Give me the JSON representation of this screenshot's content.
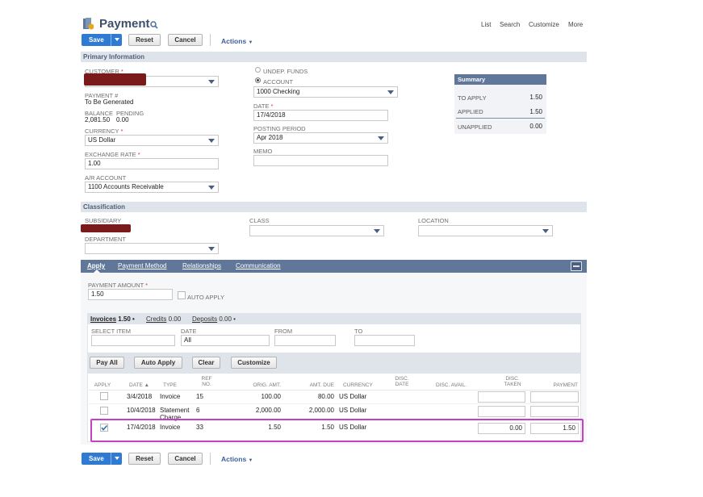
{
  "header": {
    "title": "Payment",
    "nav": [
      "List",
      "Search",
      "Customize",
      "More"
    ]
  },
  "toolbar": {
    "save": "Save",
    "reset": "Reset",
    "cancel": "Cancel",
    "actions": "Actions"
  },
  "primary": {
    "section_title": "Primary Information",
    "customer_label": "CUSTOMER",
    "required_mark": "*",
    "payment_no_label": "PAYMENT #",
    "payment_no_value": "To Be Generated",
    "balance_label": "BALANCE",
    "pending_label": "PENDING",
    "balance_value": "2,081.50",
    "pending_value": "0.00",
    "currency_label": "CURRENCY",
    "currency_value": "US Dollar",
    "exchange_rate_label": "EXCHANGE RATE",
    "exchange_rate_value": "1.00",
    "ar_account_label": "A/R ACCOUNT",
    "ar_account_value": "1100 Accounts Receivable",
    "undep_funds_label": "UNDEP. FUNDS",
    "account_label": "ACCOUNT",
    "account_value": "1000 Checking",
    "date_label": "DATE",
    "date_value": "17/4/2018",
    "posting_period_label": "POSTING PERIOD",
    "posting_period_value": "Apr 2018",
    "memo_label": "MEMO",
    "memo_value": ""
  },
  "summary": {
    "title": "Summary",
    "to_apply_label": "TO APPLY",
    "to_apply_value": "1.50",
    "applied_label": "APPLIED",
    "applied_value": "1.50",
    "unapplied_label": "UNAPPLIED",
    "unapplied_value": "0.00"
  },
  "classification": {
    "section_title": "Classification",
    "subsidiary_label": "SUBSIDIARY",
    "department_label": "DEPARTMENT",
    "class_label": "CLASS",
    "location_label": "LOCATION"
  },
  "tabs": [
    "Apply",
    "Payment Method",
    "Relationships",
    "Communication"
  ],
  "apply": {
    "payment_amount_label": "PAYMENT AMOUNT",
    "payment_amount_value": "1.50",
    "auto_apply_label": "AUTO APPLY",
    "subtabs": [
      {
        "label": "Invoices",
        "value": "1.50"
      },
      {
        "label": "Credits",
        "value": "0.00"
      },
      {
        "label": "Deposits",
        "value": "0.00"
      }
    ],
    "filters": {
      "select_item_label": "SELECT ITEM",
      "date_label": "DATE",
      "date_value": "All",
      "from_label": "FROM",
      "to_label": "TO"
    },
    "buttons": {
      "pay_all": "Pay All",
      "auto_apply": "Auto Apply",
      "clear": "Clear",
      "customize": "Customize"
    },
    "columns": [
      "APPLY",
      "DATE ▲",
      "TYPE",
      "REF NO.",
      "ORIG. AMT.",
      "AMT. DUE",
      "CURRENCY",
      "DISC. DATE",
      "DISC. AVAIL.",
      "DISC. TAKEN",
      "PAYMENT"
    ],
    "rows": [
      {
        "apply": false,
        "date": "3/4/2018",
        "type": "Invoice",
        "ref": "15",
        "orig": "100.00",
        "due": "80.00",
        "currency": "US Dollar",
        "disc_taken": "",
        "payment": ""
      },
      {
        "apply": false,
        "date": "10/4/2018",
        "type": "Statement Charge",
        "ref": "6",
        "orig": "2,000.00",
        "due": "2,000.00",
        "currency": "US Dollar",
        "disc_taken": "",
        "payment": ""
      },
      {
        "apply": true,
        "date": "17/4/2018",
        "type": "Invoice",
        "ref": "33",
        "orig": "1.50",
        "due": "1.50",
        "currency": "US Dollar",
        "disc_taken": "0.00",
        "payment": "1.50"
      }
    ]
  },
  "colors": {
    "primary_button": "#2f7bd4",
    "tab_bar": "#607799",
    "section_bar": "#dfe4eb",
    "highlight": "#c640c6",
    "link": "#255599"
  }
}
